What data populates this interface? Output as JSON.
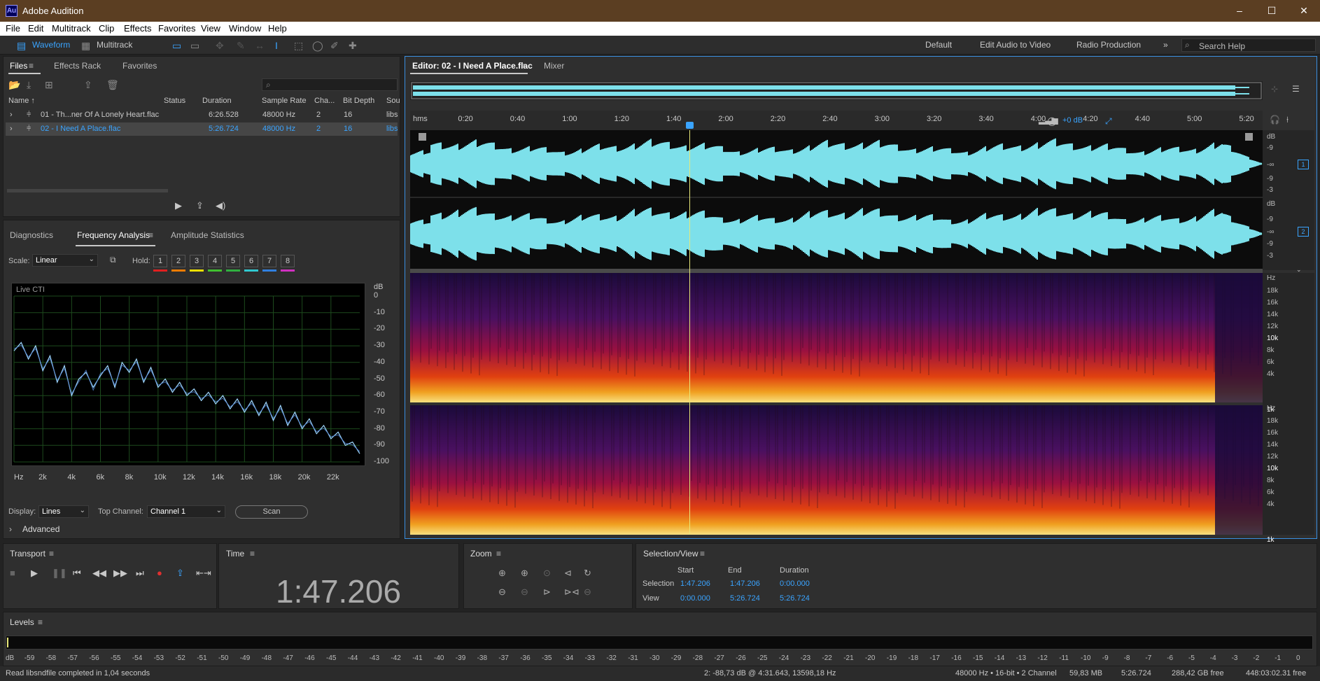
{
  "window": {
    "app_icon": "Au",
    "title": "Adobe Audition",
    "controls": [
      "–",
      "☐",
      "✕"
    ]
  },
  "menu": [
    "File",
    "Edit",
    "Multitrack",
    "Clip",
    "Effects",
    "Favorites",
    "View",
    "Window",
    "Help"
  ],
  "toolbar": {
    "waveform": "Waveform",
    "multitrack": "Multitrack",
    "workspaces": [
      "Default",
      "Edit Audio to Video",
      "Radio Production"
    ],
    "more": "»",
    "search_placeholder": "Search Help"
  },
  "files_panel": {
    "tabs": [
      "Files",
      "Effects Rack",
      "Favorites"
    ],
    "columns": [
      "Name ↑",
      "Status",
      "Duration",
      "Sample Rate",
      "Cha...",
      "Bit Depth",
      "Sou"
    ],
    "rows": [
      {
        "name": "01 - Th...ner Of A Lonely Heart.flac",
        "status": "",
        "duration": "6:26.528",
        "rate": "48000 Hz",
        "ch": "2",
        "bits": "16",
        "src": "libs"
      },
      {
        "name": "02 - I Need A Place.flac",
        "status": "",
        "duration": "5:26.724",
        "rate": "48000 Hz",
        "ch": "2",
        "bits": "16",
        "src": "libs"
      }
    ]
  },
  "analysis_panel": {
    "tabs": [
      "Diagnostics",
      "Frequency Analysis",
      "Amplitude Statistics"
    ],
    "scale_label": "Scale:",
    "scale_value": "Linear",
    "hold_label": "Hold:",
    "hold_buttons": [
      "1",
      "2",
      "3",
      "4",
      "5",
      "6",
      "7",
      "8"
    ],
    "hold_colors": [
      "#e02020",
      "#f07c00",
      "#f0e000",
      "#40c030",
      "#30b040",
      "#30c8d0",
      "#3080e0",
      "#d030c0"
    ],
    "live_label": "Live CTI",
    "display_label": "Display:",
    "display_value": "Lines",
    "top_channel_label": "Top Channel:",
    "top_channel_value": "Channel 1",
    "scan_button": "Scan",
    "advanced": "Advanced"
  },
  "chart_data": {
    "type": "line",
    "title": "",
    "xlabel": "",
    "ylabel": "dB",
    "x_ticks": [
      "Hz",
      "2k",
      "4k",
      "6k",
      "8k",
      "10k",
      "12k",
      "14k",
      "16k",
      "18k",
      "20k",
      "22k"
    ],
    "y_ticks": [
      "dB",
      "0",
      "-10",
      "-20",
      "-30",
      "-40",
      "-50",
      "-60",
      "-70",
      "-80",
      "-90",
      "-100"
    ],
    "xlim": [
      0,
      24000
    ],
    "ylim": [
      -100,
      0
    ],
    "series": [
      {
        "x": [
          0,
          500,
          1000,
          1500,
          2000,
          2500,
          3000,
          3500,
          4000,
          4500,
          5000,
          5500,
          6000,
          6500,
          7000,
          7500,
          8000,
          8500,
          9000,
          9500,
          10000,
          10500,
          11000,
          11500,
          12000,
          12500,
          13000,
          13500,
          14000,
          14500,
          15000,
          15500,
          16000,
          16500,
          17000,
          17500,
          18000,
          18500,
          19000,
          19500,
          20000,
          20500,
          21000,
          21500,
          22000,
          22500,
          23000,
          23500,
          24000
        ],
        "values": [
          -33,
          -28,
          -38,
          -30,
          -45,
          -36,
          -52,
          -42,
          -60,
          -50,
          -46,
          -55,
          -48,
          -42,
          -55,
          -40,
          -46,
          -38,
          -52,
          -43,
          -55,
          -50,
          -58,
          -52,
          -60,
          -56,
          -63,
          -58,
          -65,
          -60,
          -68,
          -62,
          -70,
          -63,
          -72,
          -64,
          -75,
          -66,
          -78,
          -70,
          -80,
          -74,
          -83,
          -78,
          -86,
          -82,
          -90,
          -88,
          -95
        ]
      }
    ],
    "line_color": "#9fd8ff"
  },
  "editor": {
    "tabs": [
      "Editor: 02 - I Need A Place.flac",
      "Mixer"
    ],
    "ruler_labels": [
      "hms",
      "0:20",
      "0:40",
      "1:00",
      "1:20",
      "1:40",
      "2:00",
      "2:20",
      "2:40",
      "3:00",
      "3:20",
      "3:40",
      "4:00",
      "4:20",
      "4:40",
      "5:00",
      "5:20"
    ],
    "gain": "+0 dB",
    "db_labels": [
      "dB",
      "-9",
      "-∞",
      "-9",
      "-3"
    ],
    "hz_labels": [
      "Hz",
      "18k",
      "16k",
      "14k",
      "12k",
      "10k",
      "8k",
      "6k",
      "4k",
      "1k"
    ],
    "channels": [
      "1",
      "2"
    ]
  },
  "transport": {
    "title": "Transport"
  },
  "time": {
    "title": "Time",
    "value": "1:47.206"
  },
  "zoom": {
    "title": "Zoom"
  },
  "selection": {
    "title": "Selection/View",
    "headers": [
      "Start",
      "End",
      "Duration"
    ],
    "rows": [
      {
        "label": "Selection",
        "start": "1:47.206",
        "end": "1:47.206",
        "dur": "0:00.000"
      },
      {
        "label": "View",
        "start": "0:00.000",
        "end": "5:26.724",
        "dur": "5:26.724"
      }
    ]
  },
  "levels": {
    "title": "Levels",
    "scale": [
      "dB",
      "-59",
      "-58",
      "-57",
      "-56",
      "-55",
      "-54",
      "-53",
      "-52",
      "-51",
      "-50",
      "-49",
      "-48",
      "-47",
      "-46",
      "-45",
      "-44",
      "-43",
      "-42",
      "-41",
      "-40",
      "-39",
      "-38",
      "-37",
      "-36",
      "-35",
      "-34",
      "-33",
      "-32",
      "-31",
      "-30",
      "-29",
      "-28",
      "-27",
      "-26",
      "-25",
      "-24",
      "-23",
      "-22",
      "-21",
      "-20",
      "-19",
      "-18",
      "-17",
      "-16",
      "-15",
      "-14",
      "-13",
      "-12",
      "-11",
      "-10",
      "-9",
      "-8",
      "-7",
      "-6",
      "-5",
      "-4",
      "-3",
      "-2",
      "-1",
      "0"
    ]
  },
  "statusbar": {
    "left": "Read libsndfile completed in 1,04 seconds",
    "cursor": "2: -88,73 dB @ 4:31.643, 13598,18 Hz",
    "format": "48000 Hz • 16-bit • 2 Channel",
    "size": "59,83 MB",
    "duration": "5:26.724",
    "free": "288,42 GB free",
    "free_time": "448:03:02.31 free"
  }
}
